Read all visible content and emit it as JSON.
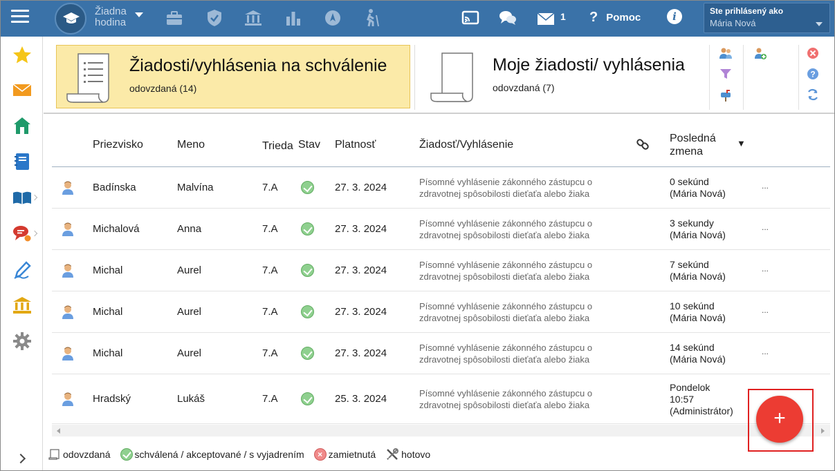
{
  "topbar": {
    "hour_line1": "Žiadna",
    "hour_line2": "hodina",
    "messages_count": "1",
    "help_label": "Pomoc",
    "info_glyph": "i",
    "user_label": "Ste prihlásený ako",
    "user_name": "Mária Nová",
    "icons": [
      "menu-icon",
      "graduation-cap-icon",
      "briefcase-icon",
      "shield-icon",
      "bank-icon",
      "bar-chart-icon",
      "compass-icon",
      "hiking-icon",
      "cast-icon",
      "chat-icon",
      "mail-icon",
      "help-icon",
      "info-icon"
    ]
  },
  "sidebar": {
    "icons": [
      "star-icon",
      "mail-icon",
      "home-icon",
      "notebook-icon",
      "book-icon",
      "chat-icon",
      "pen-icon",
      "bank-icon",
      "gear-icon"
    ]
  },
  "cards": {
    "approval": {
      "title": "Žiadosti/vyhlásenia na schválenie",
      "sub": "odovzdaná (14)"
    },
    "mine": {
      "title": "Moje žiadosti/ vyhlásenia",
      "sub": "odovzdaná (7)"
    }
  },
  "table": {
    "headers": {
      "surname": "Priezvisko",
      "name": "Meno",
      "class": "Trieda",
      "state": "Stav",
      "validity": "Platnosť",
      "request": "Žiadosť/Vyhlásenie",
      "last_change_1": "Posledná",
      "last_change_2": "zmena",
      "sort_glyph": "▼"
    },
    "rows": [
      {
        "surname": "Badínska",
        "name": "Malvína",
        "class": "7.A",
        "validity": "27. 3. 2024",
        "desc1": "Písomné vyhlásenie zákonného zástupcu o",
        "desc2": "zdravotnej spôsobilosti dieťaťa alebo žiaka",
        "chg1": "0 sekúnd",
        "chg2": "(Mária Nová)",
        "chg3": "",
        "more": "..."
      },
      {
        "surname": "Michalová",
        "name": "Anna",
        "class": "7.A",
        "validity": "27. 3. 2024",
        "desc1": "Písomné vyhlásenie zákonného zástupcu o",
        "desc2": "zdravotnej spôsobilosti dieťaťa alebo žiaka",
        "chg1": "3 sekundy",
        "chg2": "(Mária Nová)",
        "chg3": "",
        "more": "..."
      },
      {
        "surname": "Michal",
        "name": "Aurel",
        "class": "7.A",
        "validity": "27. 3. 2024",
        "desc1": "Písomné vyhlásenie zákonného zástupcu o",
        "desc2": "zdravotnej spôsobilosti dieťaťa alebo žiaka",
        "chg1": "7 sekúnd",
        "chg2": "(Mária Nová)",
        "chg3": "",
        "more": "..."
      },
      {
        "surname": "Michal",
        "name": "Aurel",
        "class": "7.A",
        "validity": "27. 3. 2024",
        "desc1": "Písomné vyhlásenie zákonného zástupcu o",
        "desc2": "zdravotnej spôsobilosti dieťaťa alebo žiaka",
        "chg1": "10 sekúnd",
        "chg2": "(Mária Nová)",
        "chg3": "",
        "more": "..."
      },
      {
        "surname": "Michal",
        "name": "Aurel",
        "class": "7.A",
        "validity": "27. 3. 2024",
        "desc1": "Písomné vyhlásenie zákonného zástupcu o",
        "desc2": "zdravotnej spôsobilosti dieťaťa alebo žiaka",
        "chg1": "14 sekúnd",
        "chg2": "(Mária Nová)",
        "chg3": "",
        "more": "..."
      },
      {
        "surname": "Hradský",
        "name": "Lukáš",
        "class": "7.A",
        "validity": "25. 3. 2024",
        "desc1": "Písomné vyhlásenie zákonného zástupcu o",
        "desc2": "zdravotnej spôsobilosti dieťaťa alebo žiaka",
        "chg1": "Pondelok",
        "chg2": "10:57",
        "chg3": "(Administrátor)",
        "more": ""
      }
    ]
  },
  "legend": {
    "submitted": "odovzdaná",
    "approved": "schválená / akceptované / s vyjadrením",
    "rejected": "zamietnutá",
    "done": "hotovo",
    "reject_glyph": "×"
  },
  "fab": {
    "glyph": "+"
  },
  "colors": {
    "topbar": "#3a72a8",
    "active_card": "#fbeaa8",
    "fab": "#ec3c33",
    "ok": "#8fd08f"
  }
}
